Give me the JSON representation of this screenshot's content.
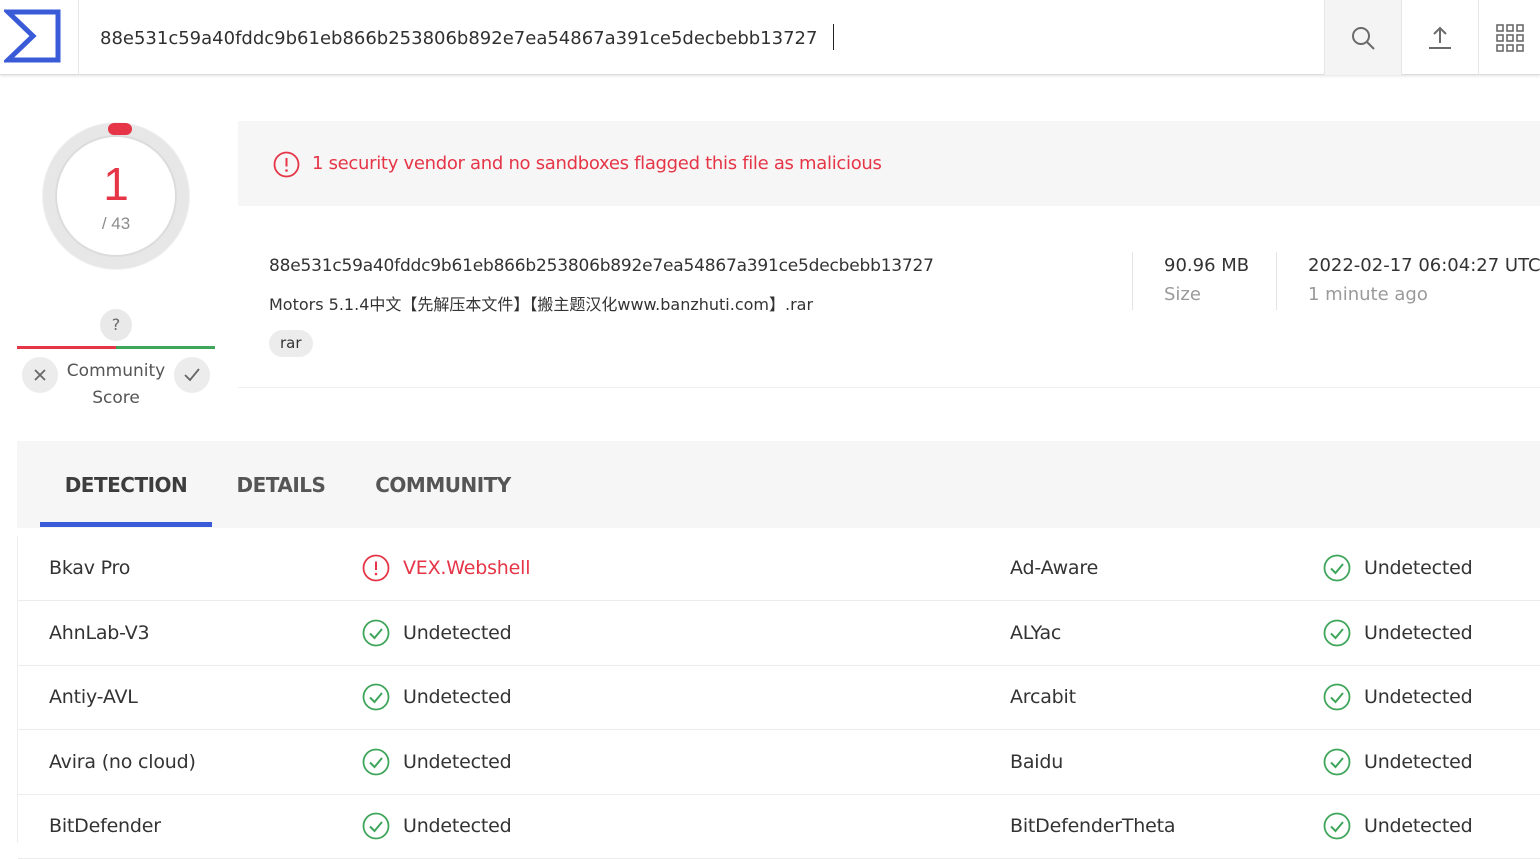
{
  "search": {
    "value": "88e531c59a40fddc9b61eb866b253806b892e7ea54867a391ce5decbebb13727"
  },
  "toolbar": {
    "icons": [
      "search-icon",
      "upload-icon",
      "apps-grid-icon"
    ]
  },
  "score": {
    "detections": "1",
    "total": "/ 43",
    "ring_color": "#e53547"
  },
  "community": {
    "question": "?",
    "label": "Community Score"
  },
  "alert": {
    "text": "1 security vendor and no sandboxes flagged this file as malicious",
    "color": "#e53547"
  },
  "file": {
    "hash": "88e531c59a40fddc9b61eb866b253806b892e7ea54867a391ce5decbebb13727",
    "name": "Motors 5.1.4中文【先解压本文件】【搬主题汉化www.banzhuti.com】.rar",
    "tag": "rar",
    "size_value": "90.96 MB",
    "size_label": "Size",
    "date_value": "2022-02-17 06:04:27 UTC",
    "date_label": "1 minute ago"
  },
  "tabs": [
    {
      "label": "DETECTION",
      "active": true
    },
    {
      "label": "DETAILS",
      "active": false
    },
    {
      "label": "COMMUNITY",
      "active": false
    }
  ],
  "detections": [
    {
      "left_vendor": "Bkav Pro",
      "left_result": "VEX.Webshell",
      "left_status": "malicious",
      "right_vendor": "Ad-Aware",
      "right_result": "Undetected",
      "right_status": "clean"
    },
    {
      "left_vendor": "AhnLab-V3",
      "left_result": "Undetected",
      "left_status": "clean",
      "right_vendor": "ALYac",
      "right_result": "Undetected",
      "right_status": "clean"
    },
    {
      "left_vendor": "Antiy-AVL",
      "left_result": "Undetected",
      "left_status": "clean",
      "right_vendor": "Arcabit",
      "right_result": "Undetected",
      "right_status": "clean"
    },
    {
      "left_vendor": "Avira (no cloud)",
      "left_result": "Undetected",
      "left_status": "clean",
      "right_vendor": "Baidu",
      "right_result": "Undetected",
      "right_status": "clean"
    },
    {
      "left_vendor": "BitDefender",
      "left_result": "Undetected",
      "left_status": "clean",
      "right_vendor": "BitDefenderTheta",
      "right_result": "Undetected",
      "right_status": "clean"
    }
  ],
  "colors": {
    "accent": "#3a5bd8",
    "malicious": "#e53547",
    "clean": "#3ea65b"
  }
}
